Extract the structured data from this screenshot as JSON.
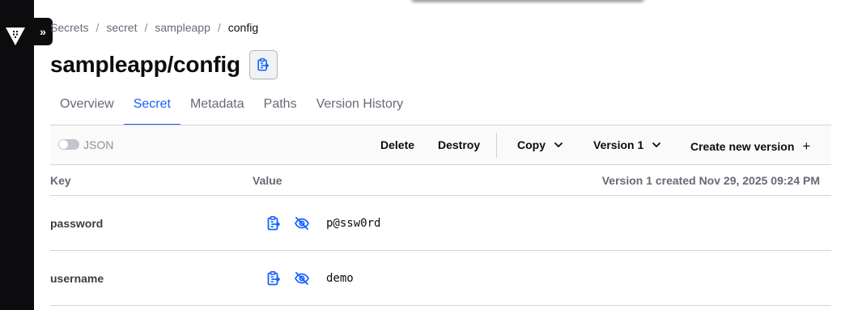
{
  "sidebar": {
    "logo_icon": "vault-logo-icon",
    "expand_label": "»"
  },
  "breadcrumb": {
    "items": [
      "Secrets",
      "secret",
      "sampleapp",
      "config"
    ],
    "separator": "/"
  },
  "page": {
    "title": "sampleapp/config",
    "copy_path_icon": "clipboard-copy-icon"
  },
  "tabs": [
    {
      "label": "Overview",
      "active": false
    },
    {
      "label": "Secret",
      "active": true
    },
    {
      "label": "Metadata",
      "active": false
    },
    {
      "label": "Paths",
      "active": false
    },
    {
      "label": "Version History",
      "active": false
    }
  ],
  "toolbar": {
    "json_label": "JSON",
    "json_toggle_on": false,
    "delete_label": "Delete",
    "destroy_label": "Destroy",
    "copy_label": "Copy",
    "version_label": "Version 1",
    "create_label": "Create new version",
    "create_symbol": "+"
  },
  "table": {
    "key_header": "Key",
    "value_header": "Value",
    "version_info": "Version 1 created Nov 29, 2025 09:24 PM",
    "rows": [
      {
        "key": "password",
        "value": "p@ssw0rd"
      },
      {
        "key": "username",
        "value": "demo"
      }
    ]
  },
  "colors": {
    "accent": "#1563ff",
    "sidebar": "#0c0c0e",
    "text_muted": "#656a76",
    "border": "#d0d3d7"
  }
}
